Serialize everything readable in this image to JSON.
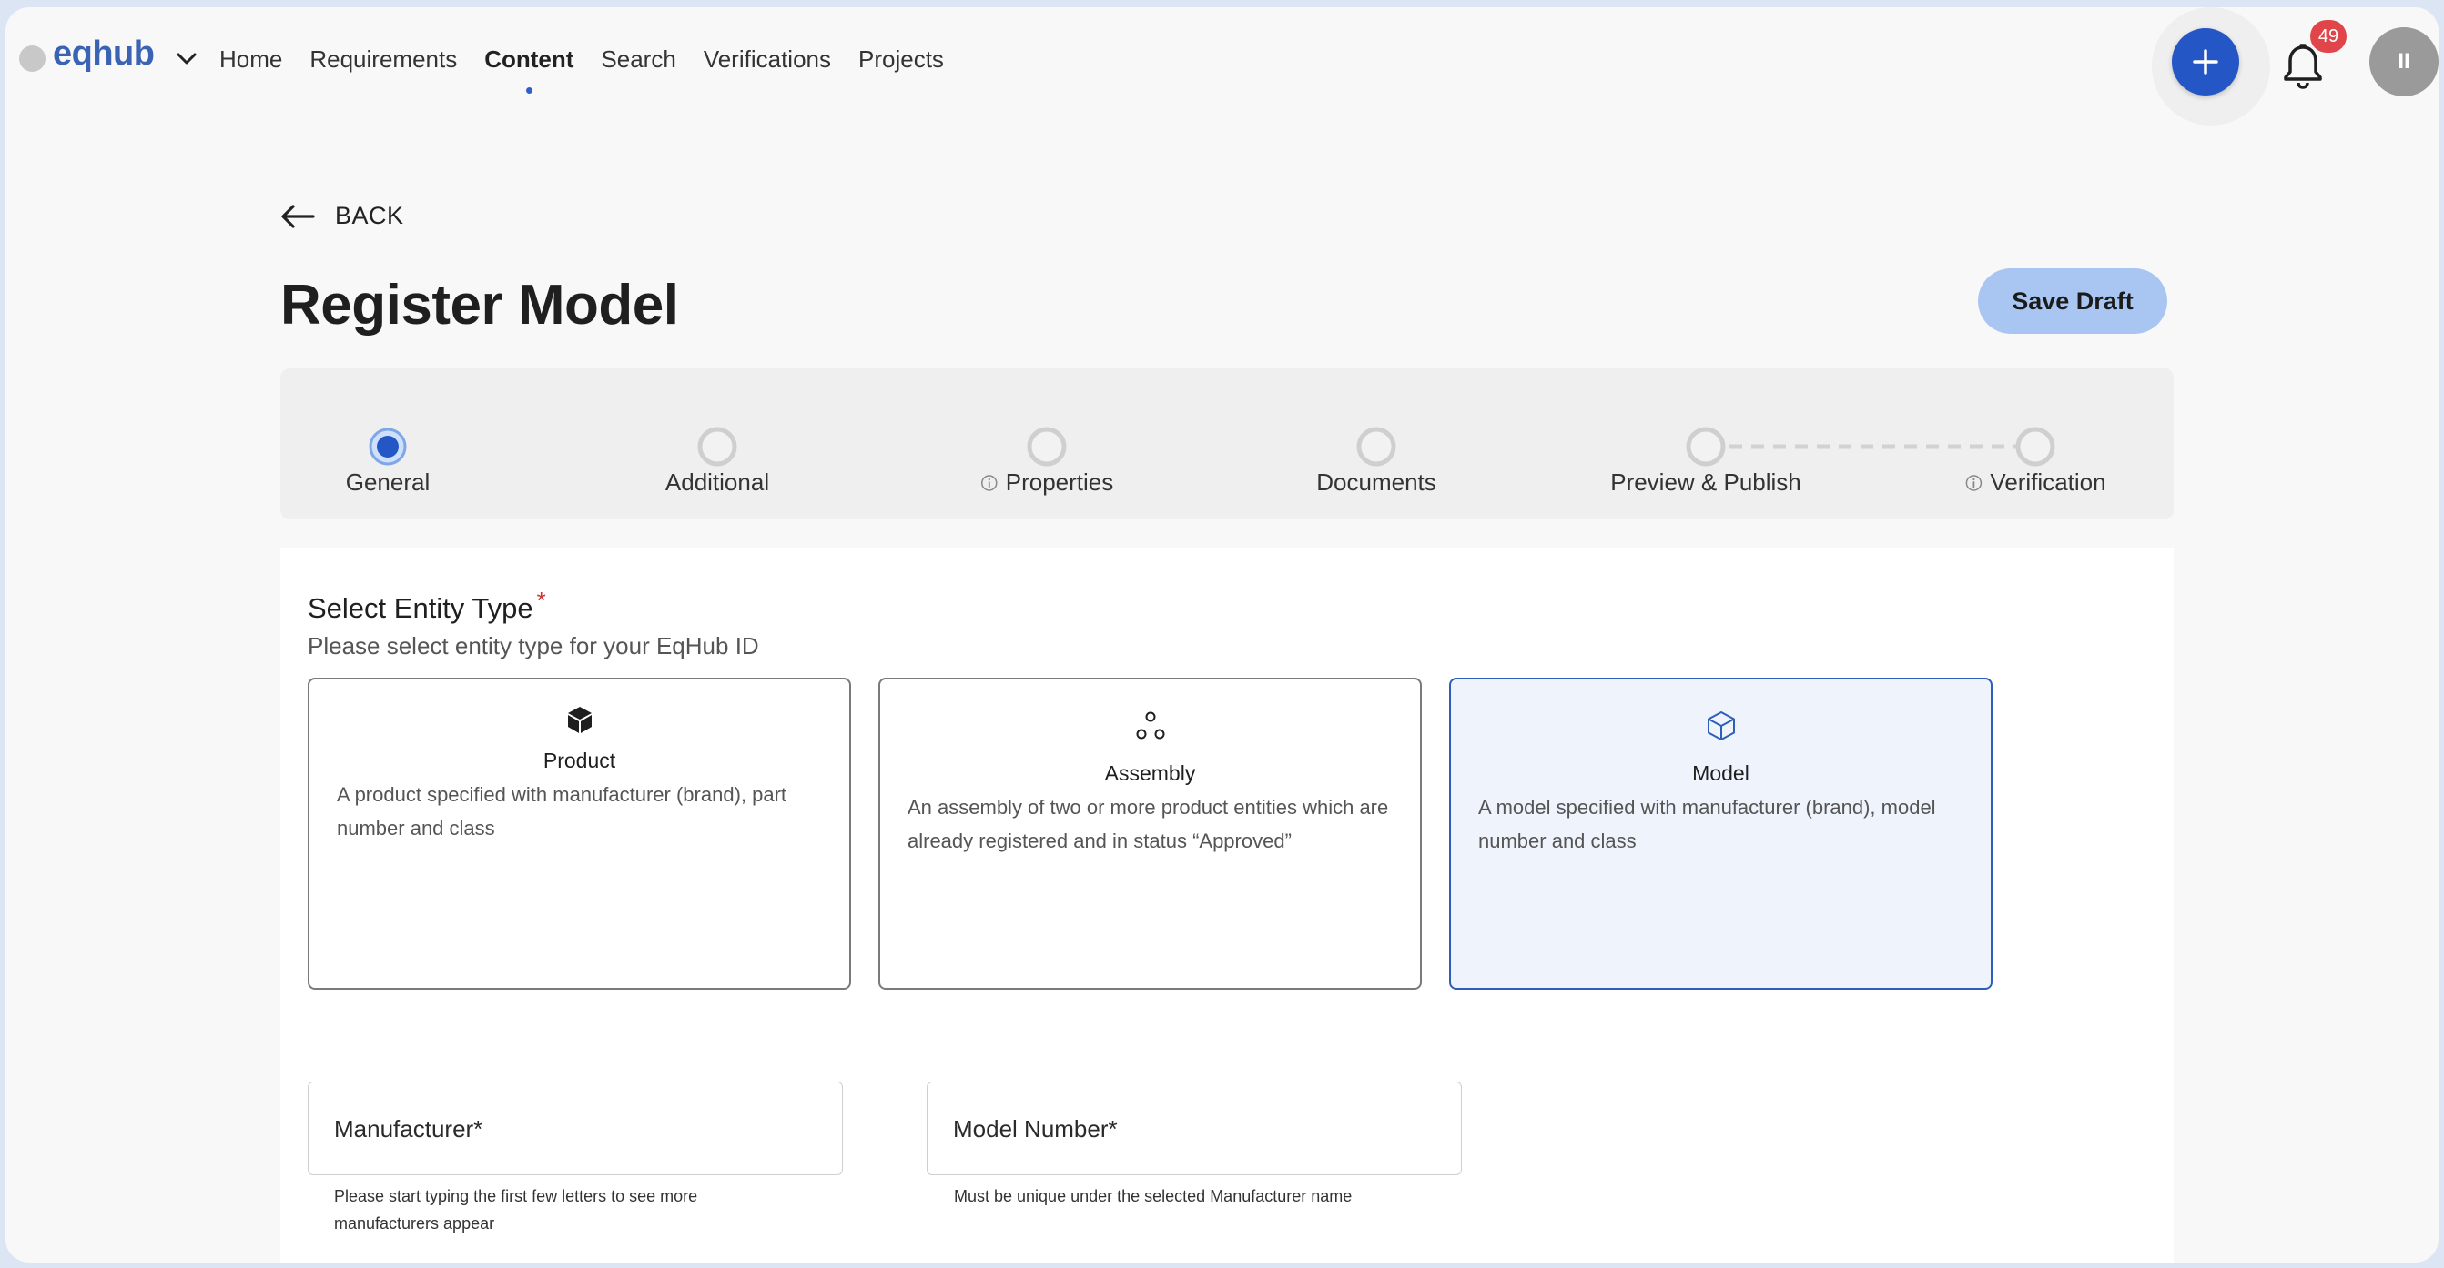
{
  "brand": {
    "name": "eqhub"
  },
  "nav": {
    "items": [
      {
        "label": "Home",
        "active": false
      },
      {
        "label": "Requirements",
        "active": false
      },
      {
        "label": "Content",
        "active": true
      },
      {
        "label": "Search",
        "active": false
      },
      {
        "label": "Verifications",
        "active": false
      },
      {
        "label": "Projects",
        "active": false
      }
    ]
  },
  "header": {
    "notifications_count": "49",
    "avatar_initials": "II",
    "add_icon": "plus-icon",
    "bell_icon": "bell-icon"
  },
  "page": {
    "back_label": "BACK",
    "title": "Register Model",
    "save_draft_label": "Save Draft"
  },
  "stepper": {
    "current_step": 0,
    "steps": [
      {
        "label": "General",
        "info": false
      },
      {
        "label": "Additional",
        "info": false
      },
      {
        "label": "Properties",
        "info": true
      },
      {
        "label": "Documents",
        "info": false
      },
      {
        "label": "Preview & Publish",
        "info": false
      },
      {
        "label": "Verification",
        "info": true
      }
    ]
  },
  "entity_type": {
    "title": "Select Entity Type",
    "required_mark": "*",
    "subtitle": "Please select entity type for your EqHub ID",
    "options": [
      {
        "name": "Product",
        "icon": "cube-filled-icon",
        "description": "A product specified with manufacturer (brand), part number and class",
        "selected": false
      },
      {
        "name": "Assembly",
        "icon": "three-circles-icon",
        "description": "An assembly of two or more product entities which are already registered and in status “Approved”",
        "selected": false
      },
      {
        "name": "Model",
        "icon": "cube-outline-icon",
        "description": "A model specified with manufacturer (brand), model number and class",
        "selected": true
      }
    ]
  },
  "fields": {
    "manufacturer": {
      "label": "Manufacturer*",
      "hint_line1": "Please start typing the first few letters to see more",
      "hint_line2": "manufacturers appear"
    },
    "model_number": {
      "label": "Model Number*",
      "hint": "Must be unique under the selected Manufacturer name"
    }
  },
  "colors": {
    "accent": "#2456c6",
    "brand": "#3b63b4",
    "badge": "#e0454a",
    "save_draft": "#a9c6f3",
    "selected_card_bg": "#eef3fc",
    "track_start": "#3b7de0",
    "track_end": "#5cb85c"
  }
}
